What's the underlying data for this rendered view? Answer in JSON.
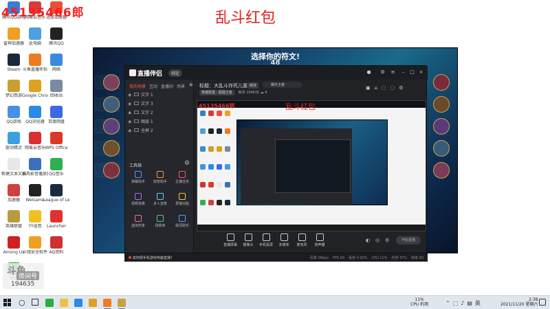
{
  "overlay": {
    "stream_id": "45135466郎",
    "title": "乱斗红包",
    "logo_big": "斗鱼",
    "logo_chip": "房间号",
    "room_number": "194635"
  },
  "desktop_icons": [
    {
      "label": "腾讯QQ游戏",
      "color": "#3a7bd5"
    },
    {
      "label": "网易云音乐",
      "color": "#d83a3a"
    },
    {
      "label": "迅游加速器",
      "color": "#e8503a"
    },
    {
      "label": "雷神加速器",
      "color": "#f0a020"
    },
    {
      "label": "此电脑",
      "color": "#4aa0e0"
    },
    {
      "label": "腾讯QQ",
      "color": "#222222"
    },
    {
      "label": "Steam",
      "color": "#1b2838"
    },
    {
      "label": "斗鱼直播伴侣",
      "color": "#f07a20"
    },
    {
      "label": "网络",
      "color": "#3a8ae0"
    },
    {
      "label": "梦幻西游",
      "color": "#c8a030"
    },
    {
      "label": "Google Chrome",
      "color": "#e0a020"
    },
    {
      "label": "回收站",
      "color": "#7a8aa0"
    },
    {
      "label": "QQ游戏",
      "color": "#4a90e0"
    },
    {
      "label": "QQ浏览器",
      "color": "#2a8ae8"
    },
    {
      "label": "百度网盘",
      "color": "#3a6ae0"
    },
    {
      "label": "驱动精灵",
      "color": "#3aa0e0"
    },
    {
      "label": "网易云音乐",
      "color": "#d83030"
    },
    {
      "label": "WPS Office",
      "color": "#d83a2a"
    },
    {
      "label": "新建文本文档",
      "color": "#e8e8e8"
    },
    {
      "label": "暴风影音播放器",
      "color": "#3a70c0"
    },
    {
      "label": "QQ音乐",
      "color": "#30b050"
    },
    {
      "label": "加速器",
      "color": "#d04040"
    },
    {
      "label": "WeGame",
      "color": "#222222"
    },
    {
      "label": "League of Legends",
      "color": "#1a2a3a"
    },
    {
      "label": "英雄联盟",
      "color": "#b89a40"
    },
    {
      "label": "YY语音",
      "color": "#f0c020"
    },
    {
      "label": "Launcher",
      "color": "#e03030"
    },
    {
      "label": "Among Us",
      "color": "#d02020"
    },
    {
      "label": "火绒安全软件",
      "color": "#f0a020"
    },
    {
      "label": "AQ资料",
      "color": "#d03030"
    },
    {
      "label": "微信",
      "color": "#2aae3a"
    }
  ],
  "game": {
    "title": "选择你的符文!",
    "countdown": "48"
  },
  "app": {
    "logo": "直播伴侣",
    "badge": "绑定",
    "tabs": [
      "我的场景",
      "互动",
      "直播间",
      "场景"
    ],
    "active_tab": "我的场景",
    "scenes": [
      {
        "name": "文字 1"
      },
      {
        "name": "文字 3"
      },
      {
        "name": "文字 2"
      },
      {
        "name": "图层 1"
      },
      {
        "name": "全屏 2"
      }
    ],
    "tools_label": "工具箱",
    "tools": [
      {
        "label": "弹幕助手",
        "color": "#4aa0ff"
      },
      {
        "label": "房管助手",
        "color": "#ff9a3a"
      },
      {
        "label": "主播任务",
        "color": "#ff5a5a"
      },
      {
        "label": "视频连麦",
        "color": "#b06aff"
      },
      {
        "label": "多人连麦",
        "color": "#6ad0ff"
      },
      {
        "label": "录播功能",
        "color": "#ffc83a"
      },
      {
        "label": "虚拟形象",
        "color": "#ff6aa0"
      },
      {
        "label": "场景库",
        "color": "#5ac87a"
      },
      {
        "label": "歌词助手",
        "color": "#4aa0ff"
      }
    ],
    "stream_title": "标题：大乱斗炸死儿童虐",
    "stream_chip": "修改",
    "category": "娱乐王者",
    "sub_category": "英雄联盟 · 超融王者",
    "sub_room": "房间 194635",
    "sub_viewers": "4",
    "preview_title": "乱斗红包",
    "preview_id": "45135466郎",
    "bottom_items": [
      {
        "label": "直播屏幕"
      },
      {
        "label": "摄像头"
      },
      {
        "label": "手机投屏"
      },
      {
        "label": "多媒体"
      },
      {
        "label": "麦克风"
      },
      {
        "label": "扬声器"
      }
    ],
    "start_label": "开始直播",
    "status_tip": "如何把手机游戏电脑直播?",
    "status_items": [
      "码率 0Kbps",
      "FPS 60",
      "丢帧 0.00%",
      "CPU 11%",
      "内存 37%",
      "帧率 60"
    ]
  },
  "taskbar": {
    "cpu_percent": "11%",
    "cpu_label": "CPU 利用",
    "time": "2:38",
    "date": "2021/11/20 星期六",
    "apps": [
      {
        "name": "wechat",
        "color": "#2aae3a",
        "active": false
      },
      {
        "name": "explorer",
        "color": "#f0c040",
        "active": false
      },
      {
        "name": "qq",
        "color": "#2a8ae8",
        "active": false
      },
      {
        "name": "chrome",
        "color": "#e0a020",
        "active": false
      },
      {
        "name": "douyu",
        "color": "#f07a20",
        "active": true
      },
      {
        "name": "league",
        "color": "#c8a040",
        "active": true
      }
    ]
  },
  "colors": {
    "accent_red": "#e02020",
    "app_bg": "#202226",
    "taskbar_bg": "#dfe6ee"
  }
}
